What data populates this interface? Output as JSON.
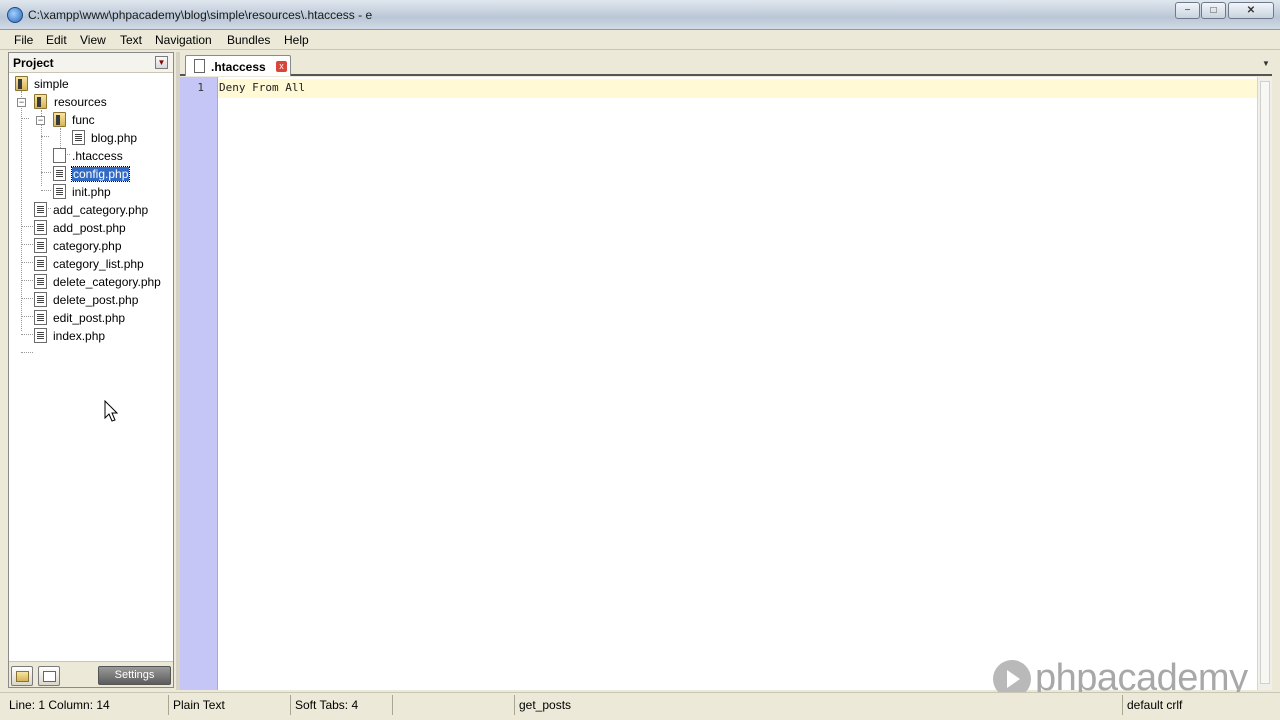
{
  "window": {
    "title": "C:\\xampp\\www\\phpacademy\\blog\\simple\\resources\\.htaccess - e",
    "controls": {
      "minimize": "−",
      "maximize": "□",
      "close": "✕"
    }
  },
  "menu": [
    "File",
    "Edit",
    "View",
    "Text",
    "Navigation",
    "Bundles",
    "Help"
  ],
  "project": {
    "title": "Project",
    "tree": [
      {
        "label": "simple",
        "type": "folder",
        "depth": 0
      },
      {
        "label": "resources",
        "type": "folder",
        "depth": 1,
        "expanded": true
      },
      {
        "label": "func",
        "type": "folder",
        "depth": 2,
        "expanded": true
      },
      {
        "label": "blog.php",
        "type": "php",
        "depth": 3
      },
      {
        "label": ".htaccess",
        "type": "plain",
        "depth": 2
      },
      {
        "label": "config.php",
        "type": "php",
        "depth": 2,
        "selected": true
      },
      {
        "label": "init.php",
        "type": "php",
        "depth": 2
      },
      {
        "label": "add_category.php",
        "type": "php",
        "depth": 1
      },
      {
        "label": "add_post.php",
        "type": "php",
        "depth": 1
      },
      {
        "label": "category.php",
        "type": "php",
        "depth": 1
      },
      {
        "label": "category_list.php",
        "type": "php",
        "depth": 1
      },
      {
        "label": "delete_category.php",
        "type": "php",
        "depth": 1
      },
      {
        "label": "delete_post.php",
        "type": "php",
        "depth": 1
      },
      {
        "label": "edit_post.php",
        "type": "php",
        "depth": 1
      },
      {
        "label": "index.php",
        "type": "php",
        "depth": 1
      }
    ],
    "settings_label": "Settings"
  },
  "tab": {
    "label": ".htaccess",
    "close": "x"
  },
  "editor": {
    "line_number": "1",
    "code": "Deny From All",
    "gutter_color": "#c6c6f6",
    "current_line_color": "#fff9d6"
  },
  "watermark": {
    "text": "phpacademy"
  },
  "status": {
    "position": "Line: 1  Column: 14",
    "language": "Plain Text",
    "tabs": "Soft Tabs: 4",
    "symbol": "get_posts",
    "line_endings": "default crlf"
  },
  "colors": {
    "selection": "#316ac5",
    "chrome": "#ece9d8"
  }
}
